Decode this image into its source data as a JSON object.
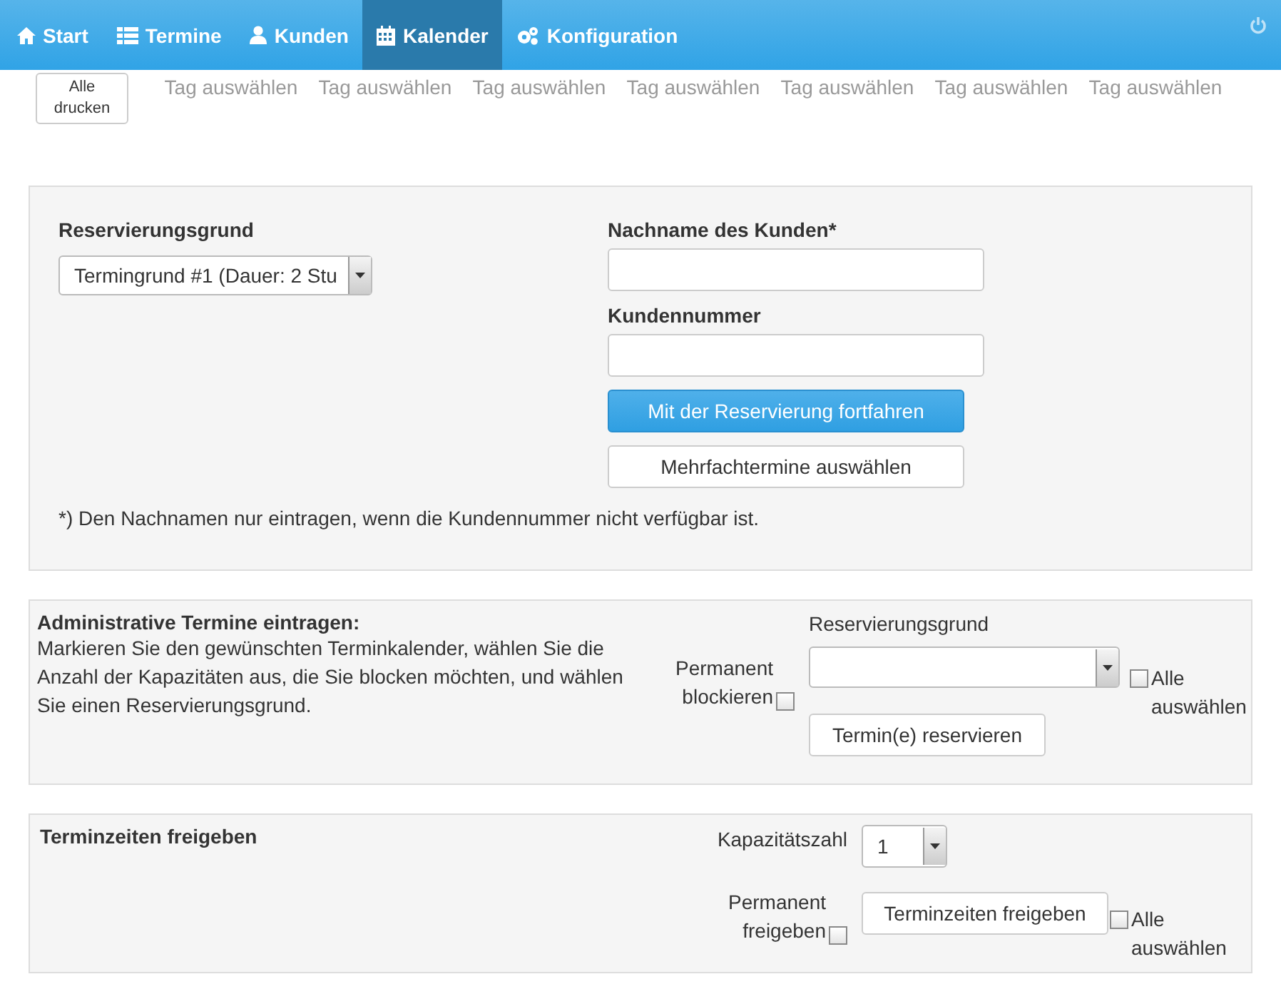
{
  "nav": {
    "items": [
      {
        "label": "Start",
        "selected": false
      },
      {
        "label": "Termine",
        "selected": false
      },
      {
        "label": "Kunden",
        "selected": false
      },
      {
        "label": "Kalender",
        "selected": true
      },
      {
        "label": "Konfiguration",
        "selected": false
      }
    ]
  },
  "day_bar": {
    "print_button": "Alle drucken",
    "day_links": [
      "Tag auswählen",
      "Tag auswählen",
      "Tag auswählen",
      "Tag auswählen",
      "Tag auswählen",
      "Tag auswählen",
      "Tag auswählen"
    ]
  },
  "reservation": {
    "reason_label": "Reservierungsgrund",
    "reason_value": "Termingrund #1 (Dauer: 2 Stu",
    "lastname_label": "Nachname des Kunden*",
    "customer_number_label": "Kundennummer",
    "continue_button": "Mit der Reservierung fortfahren",
    "multi_button": "Mehrfachtermine auswählen",
    "footnote": "*) Den Nachnamen nur eintragen, wenn die Kundennummer nicht verfügbar ist."
  },
  "admin": {
    "title": "Administrative Termine eintragen:",
    "description": "Markieren Sie den gewünschten Terminkalender, wählen Sie die Anzahl der Kapazitäten aus, die Sie blocken möchten, und wählen Sie einen Reservierungsgrund.",
    "reason_label": "Reservierungsgrund",
    "permanent_label": "Permanent blockieren",
    "permanent_checked": false,
    "select_all_label": "Alle auswählen",
    "select_all_checked": false,
    "reserve_button": "Termin(e) reservieren"
  },
  "release": {
    "title": "Terminzeiten freigeben",
    "capacity_label": "Kapazitätszahl",
    "capacity_value": "1",
    "permanent_label": "Permanent freigeben",
    "permanent_checked": false,
    "release_button": "Terminzeiten freigeben",
    "select_all_label": "Alle auswählen",
    "select_all_checked": false
  }
}
